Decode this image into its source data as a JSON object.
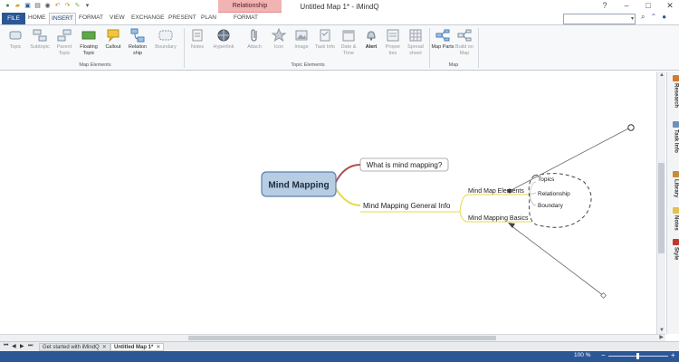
{
  "window": {
    "title": "Untitled Map 1* - iMindQ",
    "context_tab": "Relationship"
  },
  "ribbon_tabs": [
    "FILE",
    "HOME",
    "INSERT",
    "FORMAT",
    "VIEW",
    "EXCHANGE",
    "PRESENT",
    "PLAN",
    "FORMAT"
  ],
  "groups": {
    "map_elements": "Map Elements",
    "topic_elements": "Topic Elements",
    "map": "Map"
  },
  "buttons": {
    "topic": "Topic",
    "subtopic": "Subtopic",
    "parent_topic": "Parent Topic",
    "floating_topic": "Floating Topic",
    "callout": "Callout",
    "relationship": "Relation ship",
    "boundary": "Boundary",
    "notes": "Notes",
    "hyperlink": "Hyperlink",
    "attach": "Attach",
    "icon": "Icon",
    "image": "Image",
    "task_info": "Task Info",
    "date_time": "Date & Time",
    "alert": "Alert",
    "properties": "Proper ties",
    "spreadsheet": "Spread sheet",
    "map_parts": "Map Parts",
    "build_on_map": "Build on Map"
  },
  "side_tabs": [
    "Research",
    "Task Info",
    "Library",
    "Notes",
    "Style"
  ],
  "mindmap": {
    "central": "Mind Mapping",
    "topic1": "What is mind mapping?",
    "topic2": "Mind Mapping General Info",
    "sub1": "Mind Map Elements",
    "sub2": "Mind Mapping Basics",
    "leaf1": "Topics",
    "leaf2": "Relationship",
    "leaf3": "Boundary"
  },
  "doc_tabs": {
    "tab1": "Get started with iMindQ",
    "tab2": "Untitled Map 1*"
  },
  "status": {
    "zoom": "100 %"
  },
  "colors": {
    "accent": "#2b5797",
    "central_fill": "#b7cde3",
    "branch_red": "#b84a4a",
    "branch_yellow": "#e8d84a"
  }
}
